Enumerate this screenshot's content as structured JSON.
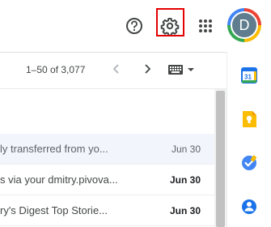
{
  "header": {
    "help_icon": "help-circle-icon",
    "settings_icon": "gear-icon",
    "apps_icon": "apps-grid-icon",
    "avatar_initial": "D"
  },
  "toolbar": {
    "page_range": "1–50 of 3,077",
    "prev_icon": "chevron-left-icon",
    "next_icon": "chevron-right-icon",
    "input_tools_icon": "keyboard-icon"
  },
  "messages": [
    {
      "snippet": "ly transferred from yo...",
      "date": "Jun 30",
      "unread": false
    },
    {
      "snippet": "s via your dmitry.pivova...",
      "date": "Jun 30",
      "unread": true
    },
    {
      "snippet": "ry's Digest Top Storie...",
      "date": "Jun 30",
      "unread": true
    }
  ],
  "side_panel": {
    "calendar_icon": "calendar-icon",
    "calendar_day": "31",
    "keep_icon": "keep-icon",
    "tasks_icon": "tasks-icon",
    "contacts_icon": "contacts-icon"
  },
  "colors": {
    "highlight": "#e50000",
    "calendar_blue": "#1a73e8",
    "keep_yellow": "#fbbc04",
    "tasks_blue": "#4285f4",
    "contacts_blue": "#1a73e8"
  }
}
